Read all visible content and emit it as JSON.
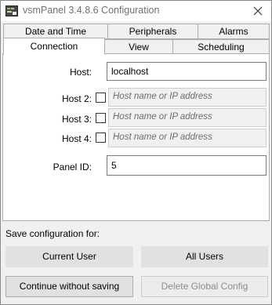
{
  "window": {
    "title": "vsmPanel 3.4.8.6 Configuration",
    "icon": "app-icon",
    "close_icon": "close-icon"
  },
  "tabs": {
    "row_top": [
      "Date and Time",
      "Peripherals",
      "Alarms"
    ],
    "row_bottom": [
      "Connection",
      "View",
      "Scheduling"
    ],
    "selected": "Connection"
  },
  "connection": {
    "host_label": "Host:",
    "host_value": "localhost",
    "host2_label": "Host 2:",
    "host3_label": "Host 3:",
    "host4_label": "Host 4:",
    "host_placeholder": "Host name or IP address",
    "host2_checked": false,
    "host3_checked": false,
    "host4_checked": false,
    "panel_id_label": "Panel ID:",
    "panel_id_value": "5"
  },
  "footer": {
    "save_label": "Save configuration for:",
    "current_user": "Current User",
    "all_users": "All Users",
    "continue_without_saving": "Continue without saving",
    "delete_global_config": "Delete Global Config"
  }
}
